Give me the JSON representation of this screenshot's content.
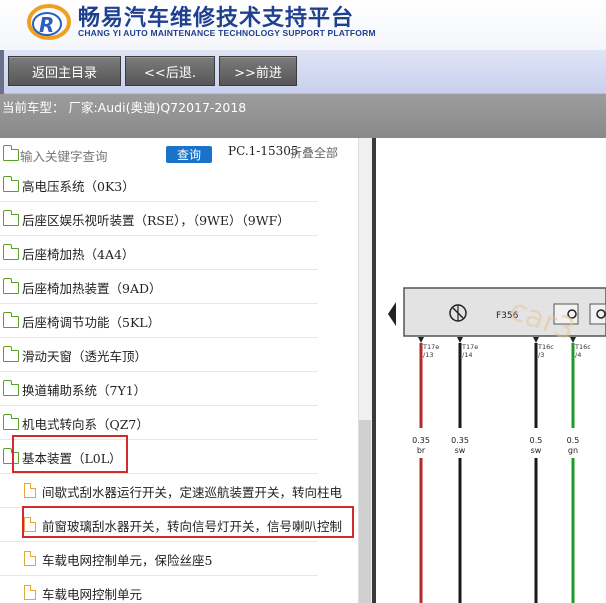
{
  "header": {
    "title": "畅易汽车维修技术支持平台",
    "subtitle": "CHANG YI AUTO MAINTENANCE TECHNOLOGY SUPPORT PLATFORM",
    "logo_letter": "R"
  },
  "nav": {
    "home": "返回主目录",
    "back": "<<后退.",
    "forward": ">>前进"
  },
  "car": {
    "text": "当前车型：  厂家:Audi(奥迪)Q72017-2018"
  },
  "search": {
    "placeholder": "输入关键字查询",
    "button": "查询",
    "range": "PC.1-15305",
    "collapse": "折叠全部"
  },
  "tree": [
    {
      "label": "高电压系统（0K3）",
      "kind": "folder"
    },
    {
      "label": "后座区娱乐视听装置（RSE），（9WE）（9WF）",
      "kind": "folder"
    },
    {
      "label": "后座椅加热（4A4）",
      "kind": "folder"
    },
    {
      "label": "后座椅加热装置（9AD）",
      "kind": "folder"
    },
    {
      "label": "后座椅调节功能（5KL）",
      "kind": "folder"
    },
    {
      "label": "滑动天窗（透光车顶）",
      "kind": "folder"
    },
    {
      "label": "换道辅助系统（7Y1）",
      "kind": "folder"
    },
    {
      "label": "机电式转向系（QZ7）",
      "kind": "folder"
    },
    {
      "label": "基本装置（L0L）",
      "kind": "folder-open"
    },
    {
      "label": "间歇式刮水器运行开关，定速巡航装置开关，转向柱电",
      "kind": "doc"
    },
    {
      "label": "前窗玻璃刮水器开关，转向信号灯开关，信号喇叭控制",
      "kind": "doc"
    },
    {
      "label": "车载电网控制单元，保险丝座5",
      "kind": "doc"
    },
    {
      "label": "车载电网控制单元",
      "kind": "doc"
    }
  ],
  "diagram": {
    "f_label": "F356",
    "watermark": "car3",
    "wires": [
      {
        "pin": "T17e",
        "num": "/13",
        "gauge": "0.35",
        "color": "br",
        "hex": "#b22a2a"
      },
      {
        "pin": "T17e",
        "num": "/14",
        "gauge": "0.35",
        "color": "sw",
        "hex": "#1a1a1a"
      },
      {
        "pin": "T16c",
        "num": "/3",
        "gauge": "0.5",
        "color": "sw",
        "hex": "#1a1a1a"
      },
      {
        "pin": "T16c",
        "num": "/4",
        "gauge": "0.5",
        "color": "gn",
        "hex": "#1e9a2a"
      }
    ]
  }
}
